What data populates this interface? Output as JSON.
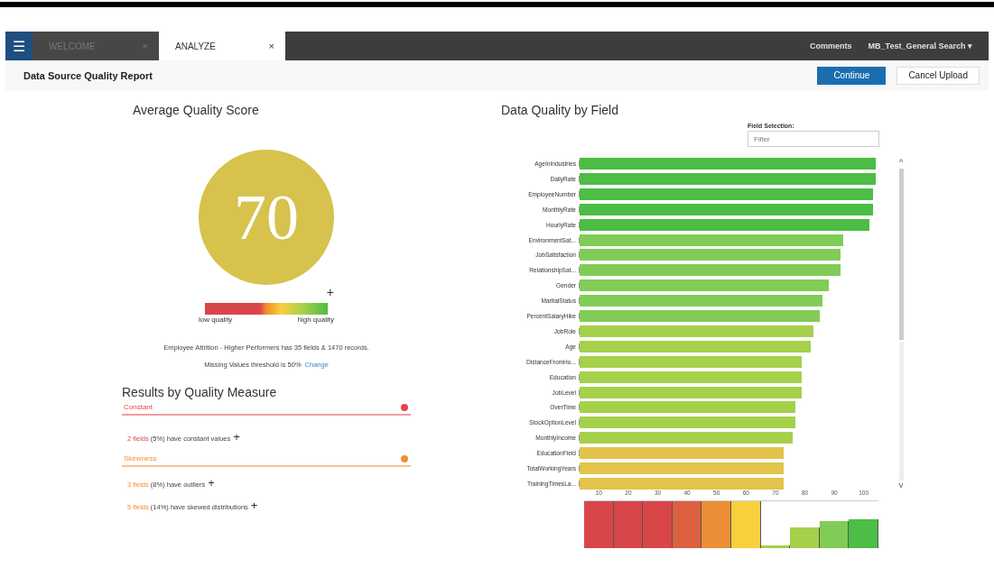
{
  "menu_button": {
    "icon": "☰"
  },
  "tabs": [
    {
      "label": "WELCOME",
      "selected": false,
      "close": "×"
    },
    {
      "label": "ANALYZE",
      "selected": true,
      "close": "×"
    }
  ],
  "top_links": [
    "Comments",
    "MB_Test_General Search ▾"
  ],
  "page_title": "Data Source Quality Report",
  "buttons": [
    {
      "label": "Continue",
      "kind": "primary"
    },
    {
      "label": "Cancel Upload",
      "kind": "secondary"
    }
  ],
  "score": {
    "title": "Average Quality Score",
    "value": "70",
    "expand": "+",
    "low_label": "low quality",
    "high_label": "high quality",
    "summary": "Employee Attrition - Higher Performers has 35 fields & 1470 records.",
    "threshold": "Missing Values threshold is 50%",
    "change_link": "Change"
  },
  "measures": {
    "title": "Results by Quality Measure",
    "groups": [
      {
        "name": "Constant",
        "color": "#e0474c",
        "items": [
          {
            "count": "2 fields",
            "text": "(5%) have constant values",
            "expand": "+"
          }
        ]
      },
      {
        "name": "Skewness",
        "color": "#ef8f2f",
        "items": [
          {
            "count": "3 fields",
            "text": "(8%) have outliers",
            "expand": "+"
          },
          {
            "count": "5 fields",
            "text": "(14%) have skewed distributions",
            "expand": "+"
          }
        ]
      }
    ]
  },
  "field_chart": {
    "title": "Data Quality by Field",
    "selection_label": "Field Selection:",
    "placeholder": "Filter",
    "fields": [
      {
        "name": "AgeInIndustries",
        "color": "#4cbd45"
      },
      {
        "name": "DailyRate",
        "color": "#4cbd45"
      },
      {
        "name": "EmployeeNumber",
        "color": "#4cbd45"
      },
      {
        "name": "MonthlyRate",
        "color": "#4cbd45"
      },
      {
        "name": "HourlyRate",
        "color": "#4cbd45"
      },
      {
        "name": "EnvironmentSat...",
        "color": "#80cc56"
      },
      {
        "name": "JobSatisfaction",
        "color": "#80cc56"
      },
      {
        "name": "RelationshipSat...",
        "color": "#80cc56"
      },
      {
        "name": "Gender",
        "color": "#80cc56"
      },
      {
        "name": "MaritalStatus",
        "color": "#80cc56"
      },
      {
        "name": "PercentSalaryHike",
        "color": "#80cc56"
      },
      {
        "name": "JobRole",
        "color": "#a6d04a"
      },
      {
        "name": "Age",
        "color": "#a6d04a"
      },
      {
        "name": "DistanceFromHo...",
        "color": "#a6d04a"
      },
      {
        "name": "Education",
        "color": "#a6d04a"
      },
      {
        "name": "JobLevel",
        "color": "#a6d04a"
      },
      {
        "name": "OverTime",
        "color": "#a6d04a"
      },
      {
        "name": "StockOptionLevel",
        "color": "#a6d04a"
      },
      {
        "name": "MonthlyIncome",
        "color": "#a6d04a"
      },
      {
        "name": "EducationField",
        "color": "#e3c34a"
      },
      {
        "name": "TotalWorkingYears",
        "color": "#e3c34a"
      },
      {
        "name": "TrainingTimesLa...",
        "color": "#e3c34a"
      }
    ],
    "scroll_up": "^",
    "scroll_down": "v",
    "histogram": {
      "ticks": [
        "10",
        "20",
        "30",
        "40",
        "50",
        "60",
        "70",
        "80",
        "90",
        "100"
      ],
      "bins": [
        {
          "color": "#d9464a"
        },
        {
          "color": "#d94649"
        },
        {
          "color": "#d94648"
        },
        {
          "color": "#dd6040"
        },
        {
          "color": "#ec8e35"
        },
        {
          "color": "#f8d03e"
        },
        {
          "color": "#a6d04b"
        },
        {
          "color": "#a6d04a"
        },
        {
          "color": "#80cc56"
        },
        {
          "color": "#4cbd45"
        }
      ]
    }
  }
}
